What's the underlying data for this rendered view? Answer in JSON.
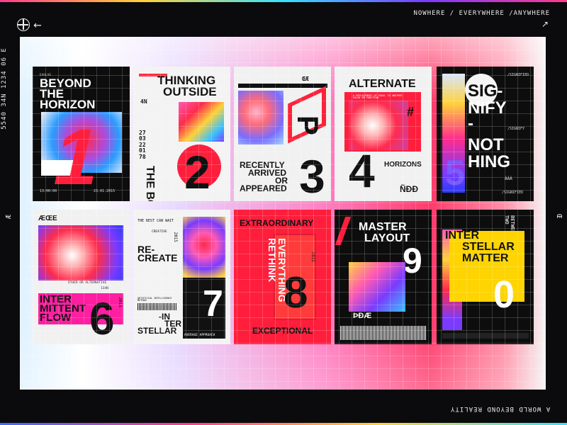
{
  "header": {
    "tagline": "NOWHERE / EVERYWHERE /ANYWHERE",
    "left_code": "5540 34N 1234 06 E"
  },
  "footer": {
    "tagline": "A WORLD BEYOND REALITY",
    "right_mark": "Œ",
    "left_mark": "Æ"
  },
  "posters": [
    {
      "title_lines": [
        "BEYOND",
        "THE",
        "HORIZON"
      ],
      "label": "EVOLVE",
      "number": "1",
      "time": "13:00:00",
      "date": "23.01.2015"
    },
    {
      "title_lines": [
        "THINKING",
        "OUTSIDE"
      ],
      "subtitle": "THE BOX",
      "number": "2",
      "code": "4N",
      "list": "27 03 22 01 78"
    },
    {
      "title_lines": [
        "RECENTLY",
        "ARRIVED",
        "OR",
        "APPEARED"
      ],
      "mark": "ŒÆ",
      "number": "3",
      "letter": "P"
    },
    {
      "title_lines": [
        "ALTERNATE"
      ],
      "subtitle": "HORIZONS",
      "number": "4",
      "glyph": "#",
      "mark": "ÑÐÐ",
      "note": "A REPLACEMENT OF EQUAL TO ANOTHER VALUE OR FUNCTION"
    },
    {
      "title_lines": [
        "SIG-",
        "NIFY",
        "-",
        "NOT",
        "HING"
      ],
      "label": "/SIGNIFIED",
      "sub": "/SIGNIFY",
      "footer": "/SIGNIFIED",
      "number": "5",
      "glyph": "ÀÀÀ"
    },
    {
      "title_lines": [
        "INTER",
        "MITTENT",
        "FLOW"
      ],
      "mark": "ÆŒE",
      "note": "OTHER OR ALTERNATIVE",
      "code": "134N",
      "number": "6",
      "year": "2015"
    },
    {
      "title_lines": [
        "RE-",
        "CREATE"
      ],
      "label": "THE BEST CAN WAIT",
      "sub": "CREATIVE",
      "year": "2015",
      "note": "ARTIFICIAL INTELLIGENCE METHOD",
      "tail_lines": [
        "-IN",
        "TER",
        "STELLAR"
      ],
      "number": "7",
      "footer": "AVERAGE APPROACH"
    },
    {
      "title_lines": [
        "EXTRAORDINARY"
      ],
      "vertical": [
        "RETHINK",
        "EVERYTHING"
      ],
      "year": "2015",
      "number": "8",
      "footer": "EXCEPTIONAL"
    },
    {
      "title_lines": [
        "MASTER",
        "LAYOUT"
      ],
      "number": "9",
      "mark": "ÞĐÆ"
    },
    {
      "title_lines": [
        "INTER",
        "STELLAR",
        "MATTER"
      ],
      "vertical": [
        "BETWEEN",
        "TWO"
      ],
      "number": "0"
    }
  ]
}
